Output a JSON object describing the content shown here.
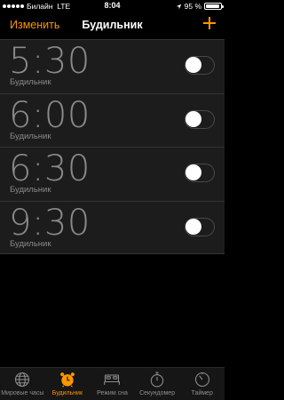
{
  "status_bar": {
    "carrier": "Билайн",
    "network": "LTE",
    "time": "8:04",
    "battery": "95 %",
    "battery_level": 0.95
  },
  "nav": {
    "edit_label": "Изменить",
    "title": "Будильник"
  },
  "alarms": [
    {
      "time": "5:30",
      "label": "Будильник",
      "enabled": false
    },
    {
      "time": "6:00",
      "label": "Будильник",
      "enabled": false
    },
    {
      "time": "6:30",
      "label": "Будильник",
      "enabled": false
    },
    {
      "time": "9:30",
      "label": "Будильник",
      "enabled": false
    }
  ],
  "tabs": [
    {
      "label": "Мировые часы",
      "icon": "globe-icon"
    },
    {
      "label": "Будильник",
      "icon": "alarm-clock-icon",
      "active": true
    },
    {
      "label": "Режим сна",
      "icon": "bed-icon"
    },
    {
      "label": "Секундомер",
      "icon": "stopwatch-icon"
    },
    {
      "label": "Таймер",
      "icon": "timer-icon"
    }
  ],
  "colors": {
    "accent": "#ff9500",
    "inactive_text": "#8a8a8a",
    "row_bg": "#1c1c1c",
    "background": "#000000"
  }
}
